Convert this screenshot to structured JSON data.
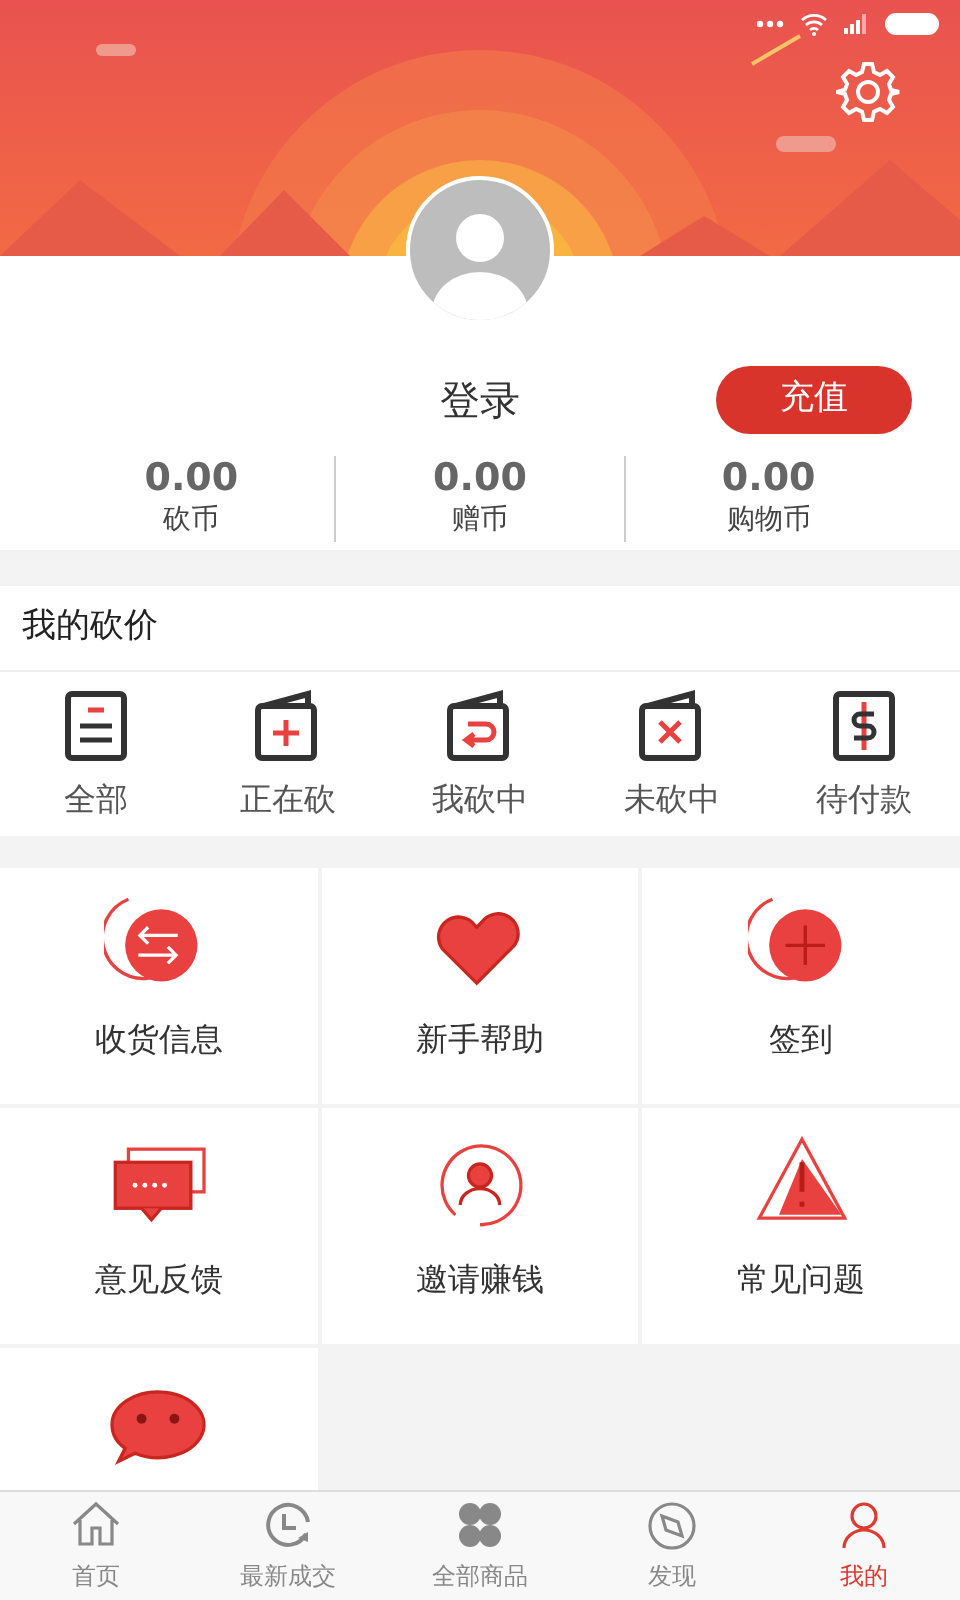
{
  "profile": {
    "login": "登录",
    "recharge": "充值"
  },
  "balances": [
    {
      "value": "0.00",
      "label": "砍币"
    },
    {
      "value": "0.00",
      "label": "赠币"
    },
    {
      "value": "0.00",
      "label": "购物币"
    }
  ],
  "bargain": {
    "title": "我的砍价",
    "items": [
      {
        "label": "全部",
        "kind": "all"
      },
      {
        "label": "正在砍",
        "kind": "cutting"
      },
      {
        "label": "我砍中",
        "kind": "won"
      },
      {
        "label": "未砍中",
        "kind": "lost"
      },
      {
        "label": "待付款",
        "kind": "pay"
      }
    ]
  },
  "services": [
    {
      "label": "收货信息",
      "kind": "address"
    },
    {
      "label": "新手帮助",
      "kind": "help"
    },
    {
      "label": "签到",
      "kind": "checkin"
    },
    {
      "label": "意见反馈",
      "kind": "feedback"
    },
    {
      "label": "邀请赚钱",
      "kind": "invite"
    },
    {
      "label": "常见问题",
      "kind": "faq"
    },
    {
      "kind": "chat"
    }
  ],
  "nav": [
    {
      "label": "首页",
      "kind": "home",
      "selected": false
    },
    {
      "label": "最新成交",
      "kind": "deals",
      "selected": false
    },
    {
      "label": "全部商品",
      "kind": "goods",
      "selected": false
    },
    {
      "label": "发现",
      "kind": "discover",
      "selected": false
    },
    {
      "label": "我的",
      "kind": "me",
      "selected": true
    }
  ]
}
